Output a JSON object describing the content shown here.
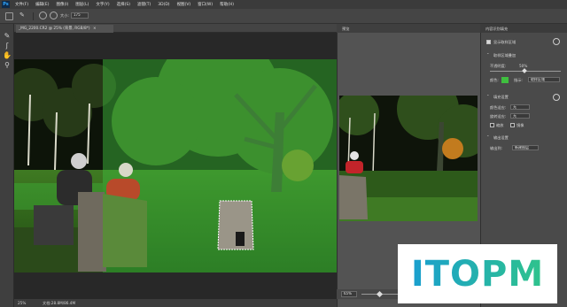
{
  "app": {
    "logo_letters": "Ps"
  },
  "menu": [
    "文件(F)",
    "编辑(E)",
    "图像(I)",
    "图层(L)",
    "文字(Y)",
    "选择(S)",
    "滤镜(T)",
    "3D(D)",
    "视图(V)",
    "窗口(W)",
    "帮助(H)"
  ],
  "options_bar": {
    "size_label": "大小:",
    "size_value": "175"
  },
  "document": {
    "tab_title": "_MG_2200.CR2 @ 25% (背景, RGB/8*)",
    "tab_close": "×"
  },
  "status": {
    "zoom": "25%",
    "doc_info": "文档:28.8M/86.4M"
  },
  "preview": {
    "title": "预览",
    "zoom_value": "65%"
  },
  "properties": {
    "title": "内容识别填充",
    "show_sampling_label": "显示取样区域",
    "sampling_section": "取样区域叠加",
    "opacity_label": "不透明度:",
    "opacity_value": "50%",
    "color_label": "颜色:",
    "overlay_color": "#3fbf3f",
    "indicate_label": "指示:",
    "indicate_value": "取样区域",
    "fill_settings_section": "填充设置",
    "color_adapt_label": "颜色适应:",
    "color_adapt_value": "无",
    "rotate_adapt_label": "旋转适应:",
    "rotate_adapt_value": "无",
    "scale_label": "缩放",
    "mirror_label": "镜像",
    "output_section": "输出设置",
    "output_to_label": "输出到:",
    "output_to_value": "新建图层"
  },
  "watermark": {
    "text": "ITOPM",
    "gradient_start": "#1a9fcf",
    "gradient_end": "#2fc38b"
  }
}
